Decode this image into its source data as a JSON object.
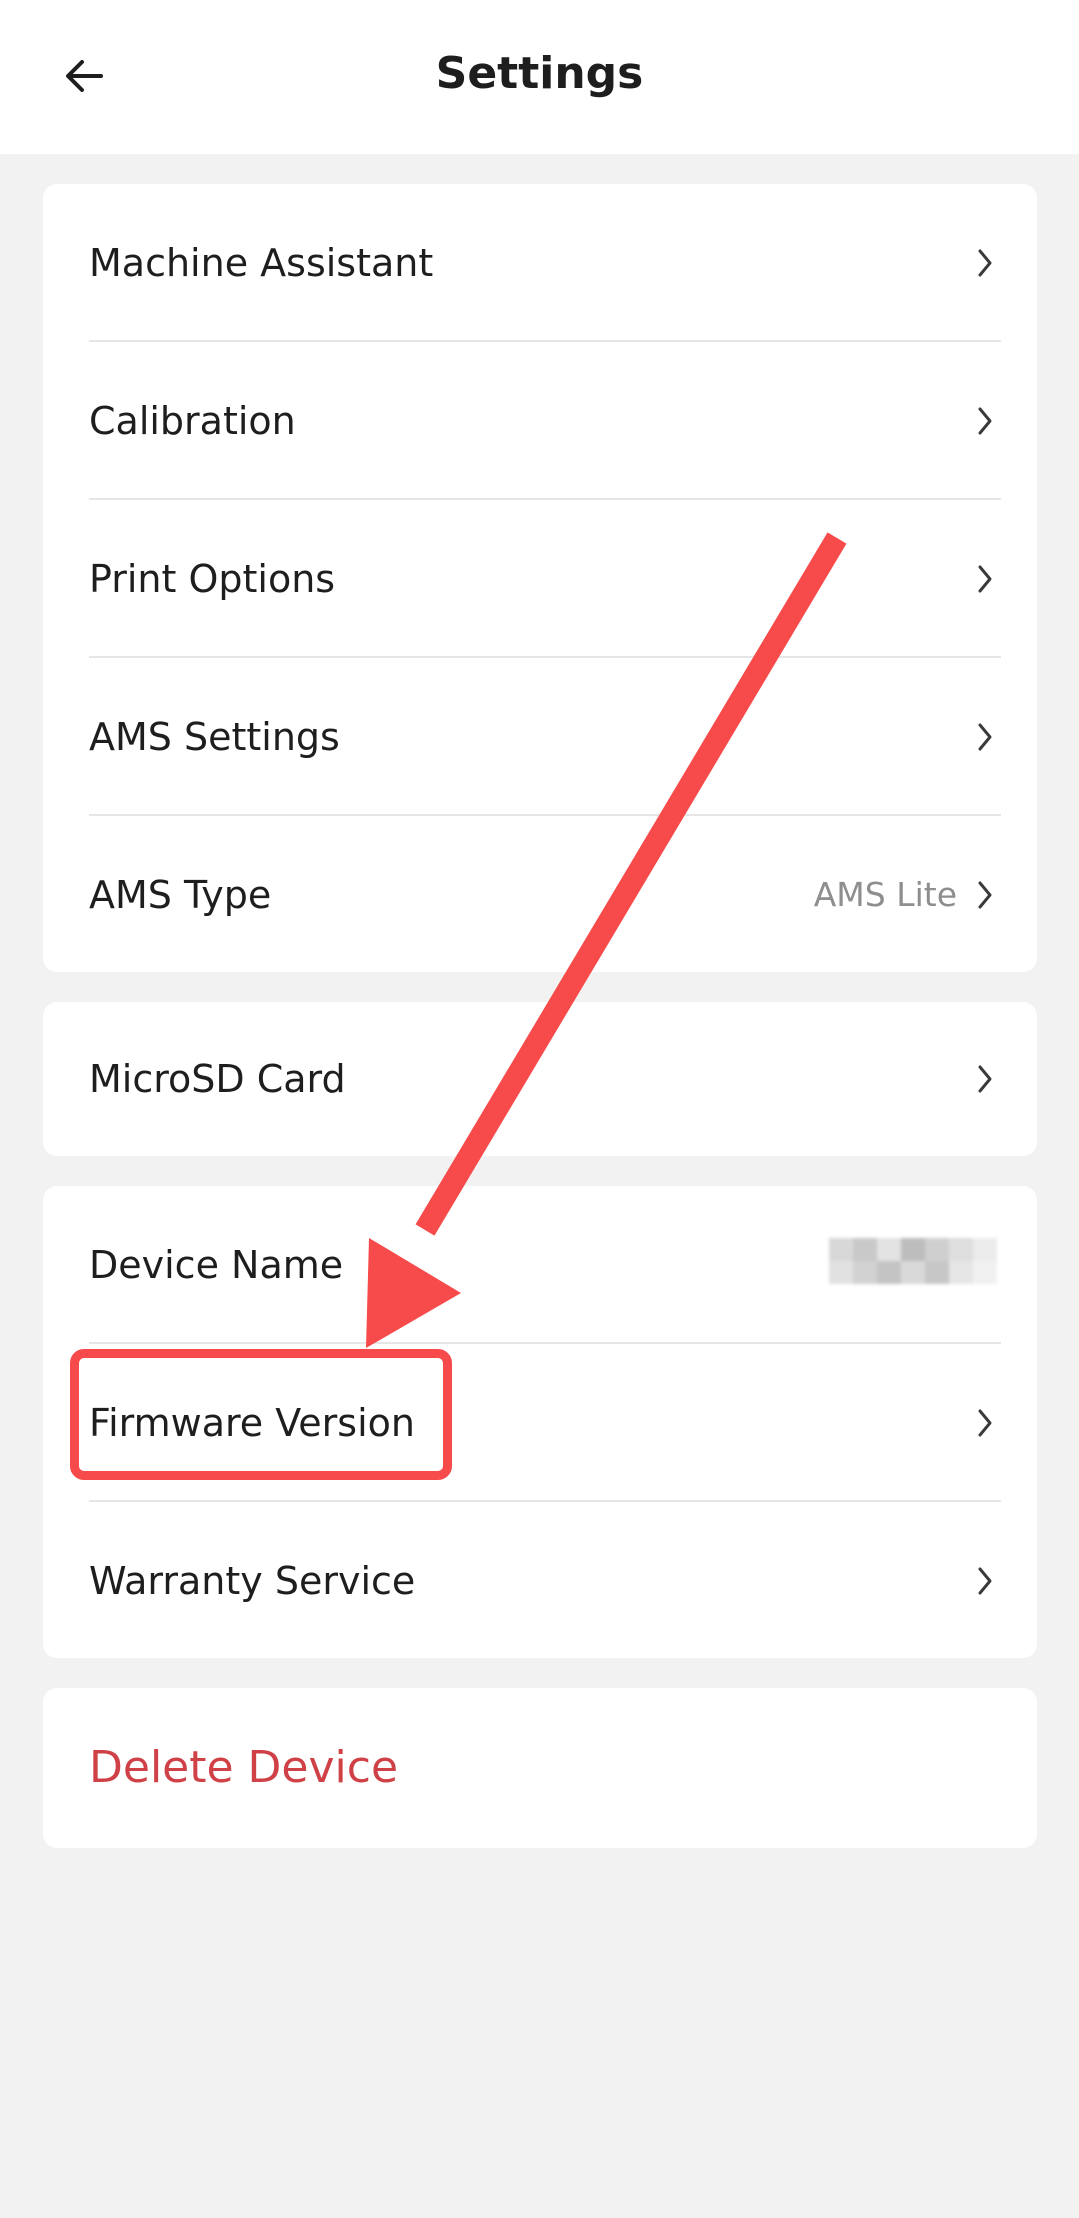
{
  "header": {
    "title": "Settings",
    "back_icon": "arrow-left-icon"
  },
  "groups": {
    "main": [
      {
        "label": "Machine Assistant"
      },
      {
        "label": "Calibration"
      },
      {
        "label": "Print Options"
      },
      {
        "label": "AMS Settings"
      },
      {
        "label": "AMS Type",
        "value": "AMS Lite"
      }
    ],
    "storage": [
      {
        "label": "MicroSD Card"
      }
    ],
    "device": [
      {
        "label": "Device Name"
      },
      {
        "label": "Firmware Version"
      },
      {
        "label": "Warranty Service"
      }
    ]
  },
  "delete": {
    "label": "Delete Device"
  },
  "colors": {
    "background": "#f2f2f2",
    "card": "#ffffff",
    "text": "#1e1e1e",
    "secondary_text": "#8e8e8e",
    "danger": "#cf4146",
    "annotation": "#f74b4b"
  }
}
